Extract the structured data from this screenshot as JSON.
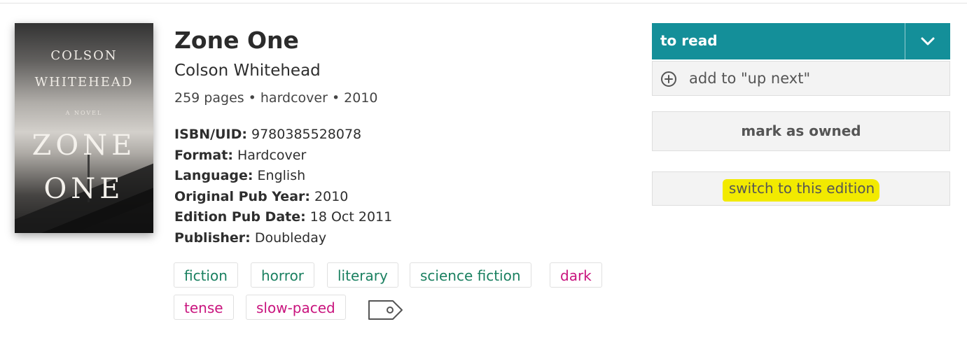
{
  "book": {
    "cover": {
      "author_line1": "COLSON",
      "author_line2": "WHITEHEAD",
      "subtitle": "A NOVEL",
      "title_line1": "ZONE",
      "title_line2": "ONE"
    },
    "title": "Zone One",
    "author": "Colson Whitehead",
    "pages": "259 pages",
    "format_short": "hardcover",
    "year": "2010",
    "separator": "•"
  },
  "facts": [
    {
      "key": "ISBN/UID:",
      "value": "9780385528078"
    },
    {
      "key": "Format:",
      "value": "Hardcover"
    },
    {
      "key": "Language:",
      "value": "English"
    },
    {
      "key": "Original Pub Year:",
      "value": "2010"
    },
    {
      "key": "Edition Pub Date:",
      "value": "18 Oct 2011"
    },
    {
      "key": "Publisher:",
      "value": "Doubleday"
    }
  ],
  "tags": {
    "genres": [
      "fiction",
      "horror",
      "literary",
      "science fiction"
    ],
    "moods": [
      "dark",
      "tense",
      "slow-paced"
    ],
    "add_icon": "tag-icon"
  },
  "actions": {
    "status_label": "to read",
    "status_dropdown_icon": "chevron-down-icon",
    "up_next_icon": "plus-circle-icon",
    "up_next_label": "add to \"up next\"",
    "owned_label": "mark as owned",
    "switch_label": "switch to this edition"
  },
  "colors": {
    "status_bg": "#148f99",
    "genre_tag": "#1a8060",
    "mood_tag": "#c9147e",
    "highlight": "#f2ea00"
  }
}
